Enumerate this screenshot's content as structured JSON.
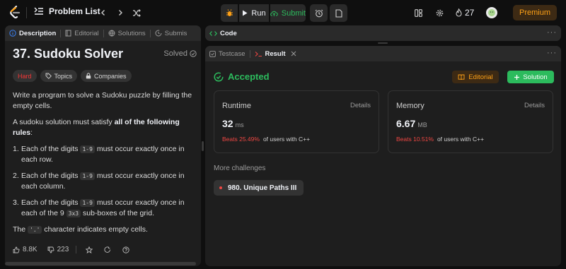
{
  "nav": {
    "problem_list_label": "Problem List",
    "run_label": "Run",
    "submit_label": "Submit",
    "streak_count": "27",
    "premium_label": "Premium"
  },
  "left": {
    "tabs": [
      {
        "label": "Description",
        "icon": "info-icon"
      },
      {
        "label": "Editorial",
        "icon": "book-icon"
      },
      {
        "label": "Solutions",
        "icon": "flask-icon"
      },
      {
        "label": "Submis",
        "icon": "history-icon"
      }
    ],
    "title": "37. Sudoku Solver",
    "status": "Solved",
    "tags": {
      "difficulty": "Hard",
      "topics": "Topics",
      "companies": "Companies"
    },
    "intro": "Write a program to solve a Sudoku puzzle by filling the empty cells.",
    "rules_prefix": "A sudoku solution must satisfy ",
    "rules_bold": "all of the following rules",
    "rules_suffix": ":",
    "rules": [
      {
        "num": "1.",
        "pre": "Each of the digits ",
        "code": "1-9",
        "post": " must occur exactly once in each row."
      },
      {
        "num": "2.",
        "pre": "Each of the digits ",
        "code": "1-9",
        "post": " must occur exactly once in each column."
      },
      {
        "num": "3.",
        "pre": "Each of the digits ",
        "code": "1-9",
        "post": " must occur exactly once in each of the 9 ",
        "code2": "3x3",
        "post2": " sub-boxes of the grid."
      }
    ],
    "empty_pre": "The ",
    "empty_code": "'.'",
    "empty_post": " character indicates empty cells.",
    "likes": "8.8K",
    "dislikes": "223"
  },
  "code_tab": {
    "label": "Code"
  },
  "result": {
    "tabs": [
      {
        "label": "Testcase",
        "icon": "checkbox-icon"
      },
      {
        "label": "Result",
        "icon": "terminal-icon"
      }
    ],
    "status": "Accepted",
    "editorial_btn": "Editorial",
    "solution_btn": "Solution",
    "runtime": {
      "label": "Runtime",
      "details": "Details",
      "value": "32",
      "unit": "ms",
      "beats": "Beats 25.49%",
      "beats_suffix": "of users with C++"
    },
    "memory": {
      "label": "Memory",
      "details": "Details",
      "value": "6.67",
      "unit": "MB",
      "beats": "Beats 10.51%",
      "beats_suffix": "of users with C++"
    },
    "more_challenges_label": "More challenges",
    "challenge": "980. Unique Paths III"
  },
  "colors": {
    "accepted": "#2cbb5d",
    "hard": "#f63636",
    "premium": "#ffa116",
    "beats": "#ef4743"
  }
}
